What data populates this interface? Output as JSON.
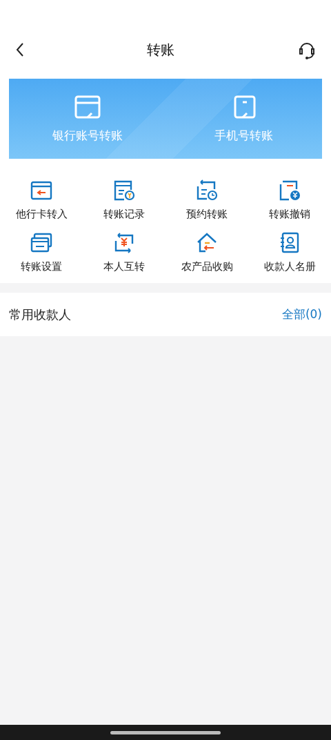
{
  "header": {
    "title": "转账"
  },
  "banner": [
    {
      "kind": "card",
      "label": "银行账号转账"
    },
    {
      "kind": "phone",
      "label": "手机号转账"
    }
  ],
  "shortcuts": [
    {
      "kind": "card-in",
      "label": "他行卡转入"
    },
    {
      "kind": "record",
      "label": "转账记录"
    },
    {
      "kind": "schedule",
      "label": "预约转账"
    },
    {
      "kind": "revoke",
      "label": "转账撤销"
    },
    {
      "kind": "settings",
      "label": "转账设置"
    },
    {
      "kind": "swap",
      "label": "本人互转"
    },
    {
      "kind": "house",
      "label": "农产品收购"
    },
    {
      "kind": "contacts",
      "label": "收款人名册"
    }
  ],
  "payees": {
    "title": "常用收款人",
    "link": "全部(0)"
  }
}
